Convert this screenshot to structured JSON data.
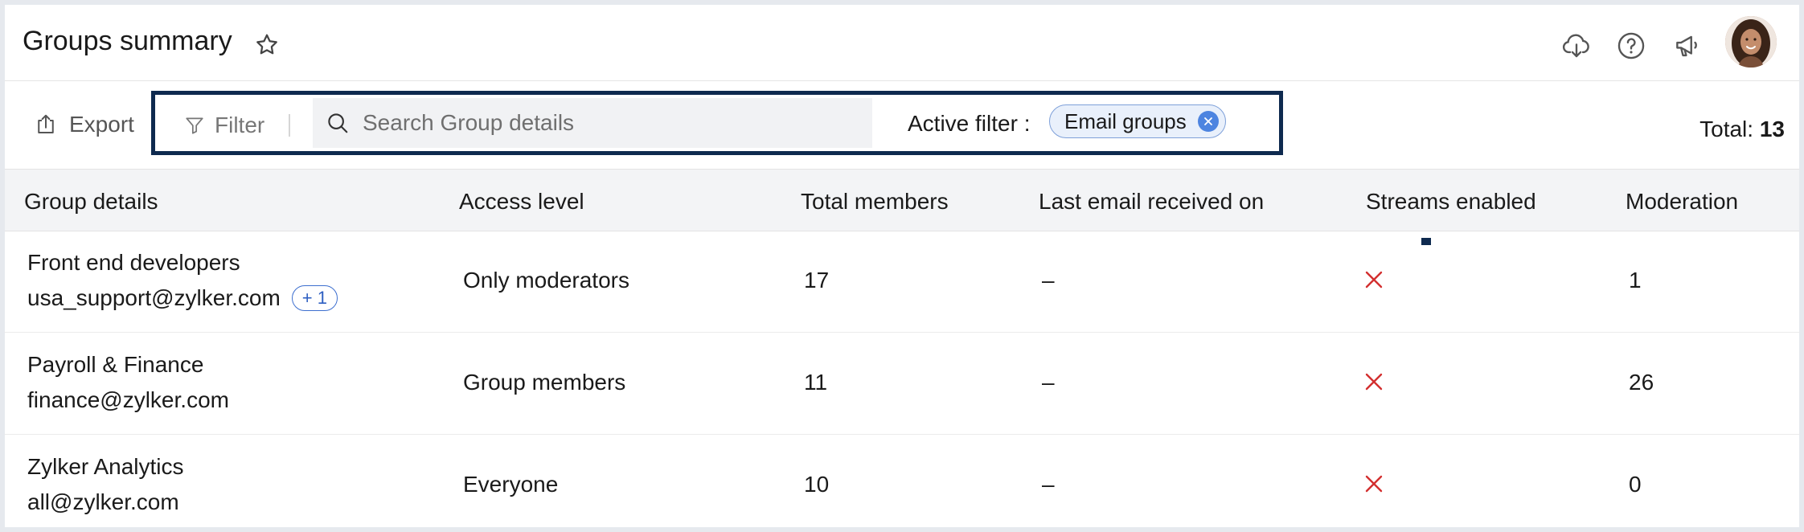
{
  "header": {
    "title": "Groups summary",
    "icons": [
      "star-icon",
      "cloud-download-icon",
      "help-icon",
      "announcement-icon",
      "avatar"
    ]
  },
  "toolbar": {
    "export_label": "Export",
    "filter_label": "Filter",
    "search_placeholder": "Search Group details",
    "active_filter_label": "Active filter :",
    "active_filter_chip": "Email groups",
    "total_label": "Total:",
    "total_value": "13"
  },
  "table": {
    "columns": [
      "Group details",
      "Access level",
      "Total members",
      "Last email received on",
      "Streams enabled",
      "Moderation"
    ],
    "rows": [
      {
        "name": "Front end developers",
        "email": "usa_support@zylker.com",
        "badge": "+ 1",
        "access": "Only moderators",
        "members": "17",
        "last_email": "–",
        "streams": "disabled",
        "moderation": "1"
      },
      {
        "name": "Payroll & Finance",
        "email": "finance@zylker.com",
        "badge": "",
        "access": "Group members",
        "members": "11",
        "last_email": "–",
        "streams": "disabled",
        "moderation": "26"
      },
      {
        "name": "Zylker Analytics",
        "email": "all@zylker.com",
        "badge": "",
        "access": "Everyone",
        "members": "10",
        "last_email": "–",
        "streams": "disabled",
        "moderation": "0"
      }
    ]
  },
  "colors": {
    "highlight_border": "#0e2a4f",
    "chip_bg": "#e9f0fb",
    "chip_close": "#4d84e0",
    "cross": "#d32f2f"
  }
}
